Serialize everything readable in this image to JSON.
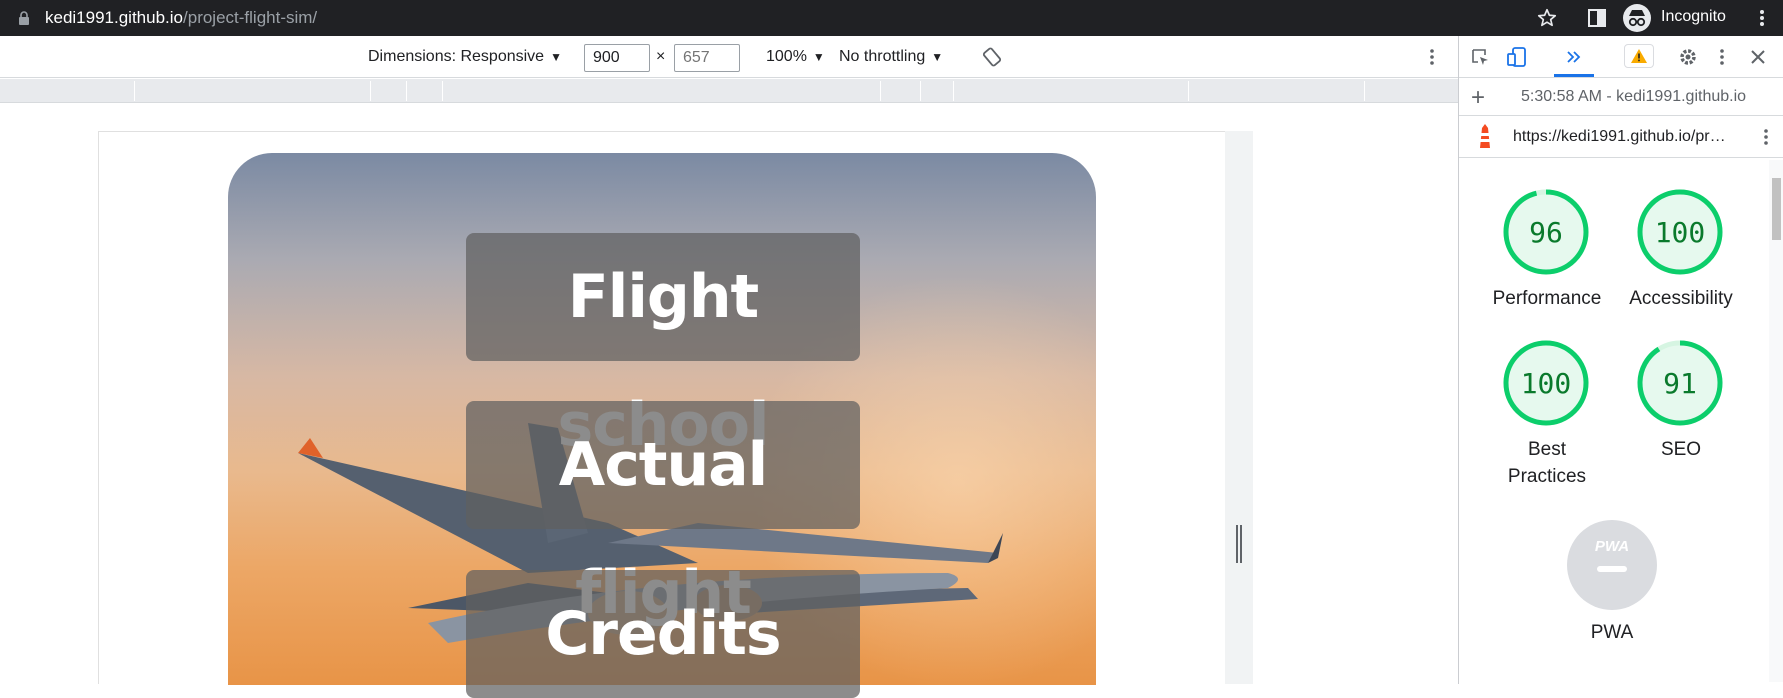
{
  "browser": {
    "url_host": "kedi1991.github.io",
    "url_path": "/project-flight-sim/",
    "profile_label": "Incognito"
  },
  "device_toolbar": {
    "dimensions_label": "Dimensions: Responsive",
    "width_value": "900",
    "height_placeholder": "657",
    "zoom_label": "100%",
    "throttle_label": "No throttling",
    "times": "×"
  },
  "page": {
    "buttons": [
      "Flight school",
      "Actual flight",
      "Credits"
    ]
  },
  "devtools": {
    "report_selector": "5:30:58 AM - kedi1991.github.io",
    "report_url": "https://kedi1991.github.io/pr…",
    "scores": [
      {
        "value": "96",
        "label": "Performance"
      },
      {
        "value": "100",
        "label": "Accessibility"
      },
      {
        "value": "100",
        "label": "Best Practices"
      },
      {
        "value": "91",
        "label": "SEO"
      }
    ],
    "pwa_label": "PWA",
    "pwa_badge": "PWA",
    "colors": {
      "pass": "#0cce6b",
      "pass_text": "#0a7a2c",
      "pass_bg": "#e6f9ee"
    }
  }
}
